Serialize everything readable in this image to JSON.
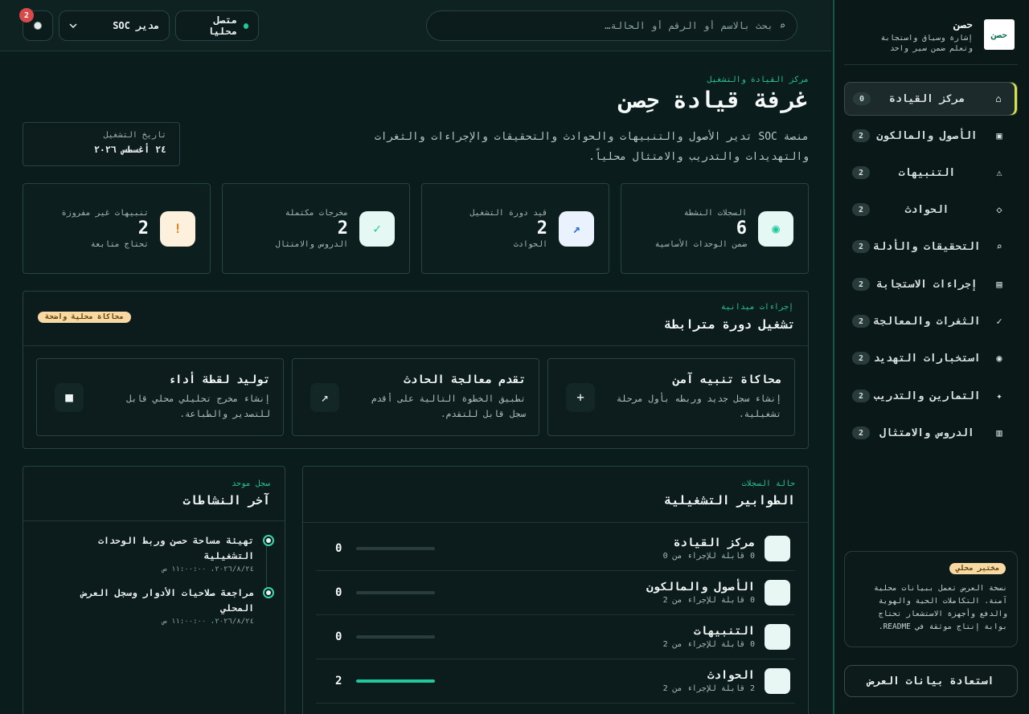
{
  "topbar": {
    "search_placeholder": "بحث بالاسم أو الرقم أو الحالة…",
    "status_label": "متصل محليا",
    "role_label": "مدير SOC",
    "notification_count": "2"
  },
  "sidebar": {
    "brand_logo": "حصن",
    "brand_name": "حصن",
    "brand_tagline": "إشارة وسياق واستجابة وتعلم ضمن سير واحد",
    "items": [
      {
        "icon": "⌂",
        "label": "مركز القيادة",
        "count": "0",
        "active": true
      },
      {
        "icon": "▣",
        "label": "الأصول والمالكون",
        "count": "2"
      },
      {
        "icon": "⚠",
        "label": "التنبيهات",
        "count": "2"
      },
      {
        "icon": "◇",
        "label": "الحوادث",
        "count": "2"
      },
      {
        "icon": "⌕",
        "label": "التحقيقات والأدلة",
        "count": "2"
      },
      {
        "icon": "▤",
        "label": "إجراءات الاستجابة",
        "count": "2"
      },
      {
        "icon": "✓",
        "label": "الثغرات والمعالجة",
        "count": "2"
      },
      {
        "icon": "◉",
        "label": "استخبارات التهديد",
        "count": "2"
      },
      {
        "icon": "✦",
        "label": "التمارين والتدريب",
        "count": "2"
      },
      {
        "icon": "▥",
        "label": "الدروس والامتثال",
        "count": "2"
      }
    ],
    "lab_badge": "مختبر محلي",
    "lab_text": "نسخة العرض تعمل ببيانات محلية آمنة. التكاملات الحية والهوية والدفع وأجهزة الاستشعار تحتاج بوابة إنتاج موثقة في README.",
    "restore_label": "استعادة بيانات العرض"
  },
  "hero": {
    "eyebrow": "مركز القيادة والتشغيل",
    "title": "غرفة قيادة حِصن",
    "description": "منصة SOC تدير الأصول والتنبيهات والحوادث والتحقيقات والإجراءات والثغرات والتهديدات والتدريب والامتثال محلياً.",
    "date_label": "تاريخ التشغيل",
    "date_value": "٢٤ أغسطس ٢٠٢٦"
  },
  "stats": [
    {
      "icon": "◉",
      "label": "السجلات النشطة",
      "value": "6",
      "sub": "ضمن الوحدات الأساسية",
      "icon_color": "#1fc99b",
      "icon_bg": "#e6f8f4"
    },
    {
      "icon": "↗",
      "label": "قيد دورة التشغيل",
      "value": "2",
      "sub": "الحوادث",
      "icon_color": "#2f6fd6",
      "icon_bg": "#eaf2fd"
    },
    {
      "icon": "✓",
      "label": "مخرجات مكتملة",
      "value": "2",
      "sub": "الدروس والامتثال",
      "icon_color": "#1fc99b",
      "icon_bg": "#e6f8f4"
    },
    {
      "icon": "!",
      "label": "تنبيهات غير مفروزة",
      "value": "2",
      "sub": "تحتاج متابعة",
      "icon_color": "#d9832b",
      "icon_bg": "#fdf0dc"
    }
  ],
  "actions": {
    "eyebrow": "إجراءات ميدانية",
    "title": "تشغيل دورة مترابطة",
    "badge": "محاكاة محلية واضحة",
    "cards": [
      {
        "icon": "+",
        "title": "محاكاة تنبيه آمن",
        "desc": "إنشاء سجل جديد وربطه بأول مرحلة تشغيلية."
      },
      {
        "icon": "↗",
        "title": "تقدم معالجة الحادث",
        "desc": "تطبيق الخطوة التالية على أقدم سجل قابل للتقدم."
      },
      {
        "icon": "■",
        "title": "توليد لقطة أداء",
        "desc": "إنشاء مخرج تحليلي محلي قابل للتصدير والطباعة."
      }
    ]
  },
  "queues": {
    "eyebrow": "حالة السجلات",
    "title": "الطوابير التشغيلية",
    "rows": [
      {
        "title": "مركز القيادة",
        "sub": "0 قابلة للإجراء من 0",
        "count": "0",
        "progress": 0
      },
      {
        "title": "الأصول والمالكون",
        "sub": "0 قابلة للإجراء من 2",
        "count": "0",
        "progress": 0
      },
      {
        "title": "التنبيهات",
        "sub": "0 قابلة للإجراء من 2",
        "count": "0",
        "progress": 0
      },
      {
        "title": "الحوادث",
        "sub": "2 قابلة للإجراء من 2",
        "count": "2",
        "progress": 1
      }
    ]
  },
  "activity": {
    "eyebrow": "سجل موحد",
    "title": "آخر النشاطات",
    "items": [
      {
        "text": "تهيئة مساحة حصن وربط الوحدات التشغيلية",
        "time": "٢٠٢٦/٨/٢٤، ١١:٠٠:٠٠ ص"
      },
      {
        "text": "مراجعة صلاحيات الأدوار وسجل العرض المحلي",
        "time": "٢٠٢٦/٨/٢٤، ١١:٠٠:٠٠ ص"
      }
    ]
  }
}
